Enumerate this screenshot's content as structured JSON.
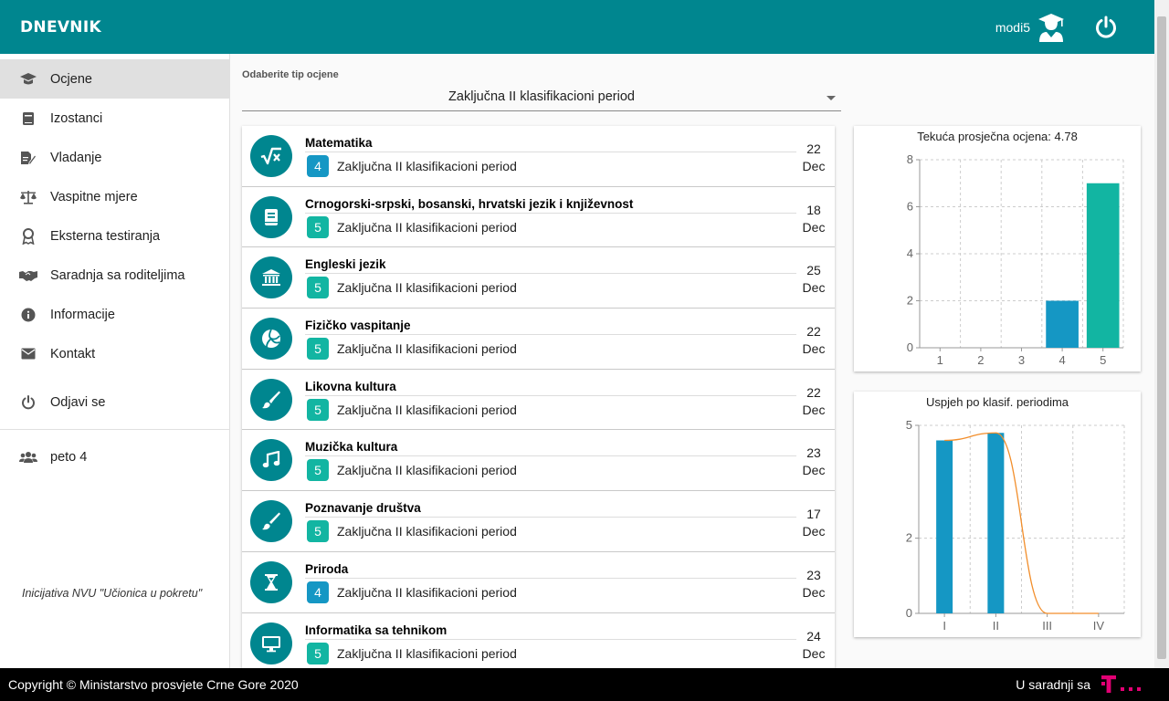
{
  "header": {
    "brand": "DNEVNIK",
    "username": "modi5"
  },
  "sidebar": {
    "items": [
      {
        "label": "Ocjene",
        "icon": "graduation-cap-icon",
        "active": true
      },
      {
        "label": "Izostanci",
        "icon": "book-icon"
      },
      {
        "label": "Vladanje",
        "icon": "edit-document-icon"
      },
      {
        "label": "Vaspitne mjere",
        "icon": "scale-icon"
      },
      {
        "label": "Eksterna testiranja",
        "icon": "award-ribbon-icon"
      },
      {
        "label": "Saradnja sa roditeljima",
        "icon": "handshake-icon"
      },
      {
        "label": "Informacije",
        "icon": "info-icon"
      },
      {
        "label": "Kontakt",
        "icon": "envelope-icon"
      }
    ],
    "logout_label": "Odjavi se",
    "class_label": "peto 4",
    "initiative": "Inicijativa NVU \"Učionica u pokretu\""
  },
  "filter": {
    "caption": "Odaberite tip ocjene",
    "selected": "Zaključna II klasifikacioni period"
  },
  "grades": [
    {
      "subject": "Matematika",
      "grade": "4",
      "period": "Zaključna II klasifikacioni period",
      "day": "22",
      "month": "Dec",
      "icon": "square-root-icon"
    },
    {
      "subject": "Crnogorski-srpski, bosanski, hrvatski jezik i književnost",
      "grade": "5",
      "period": "Zaključna II klasifikacioni period",
      "day": "18",
      "month": "Dec",
      "icon": "book-icon"
    },
    {
      "subject": "Engleski jezik",
      "grade": "5",
      "period": "Zaključna II klasifikacioni period",
      "day": "25",
      "month": "Dec",
      "icon": "bank-building-icon"
    },
    {
      "subject": "Fizičko vaspitanje",
      "grade": "5",
      "period": "Zaključna II klasifikacioni period",
      "day": "22",
      "month": "Dec",
      "icon": "volleyball-icon"
    },
    {
      "subject": "Likovna kultura",
      "grade": "5",
      "period": "Zaključna II klasifikacioni period",
      "day": "22",
      "month": "Dec",
      "icon": "paint-brush-icon"
    },
    {
      "subject": "Muzička kultura",
      "grade": "5",
      "period": "Zaključna II klasifikacioni period",
      "day": "23",
      "month": "Dec",
      "icon": "music-note-icon"
    },
    {
      "subject": "Poznavanje društva",
      "grade": "5",
      "period": "Zaključna II klasifikacioni period",
      "day": "17",
      "month": "Dec",
      "icon": "paint-brush-icon"
    },
    {
      "subject": "Priroda",
      "grade": "4",
      "period": "Zaključna II klasifikacioni period",
      "day": "23",
      "month": "Dec",
      "icon": "hourglass-icon"
    },
    {
      "subject": "Informatika sa tehnikom",
      "grade": "5",
      "period": "Zaključna II klasifikacioni period",
      "day": "24",
      "month": "Dec",
      "icon": "monitor-icon"
    }
  ],
  "chart_data": [
    {
      "type": "bar",
      "title": "Tekuća prosječna ocjena: 4.78",
      "categories": [
        "1",
        "2",
        "3",
        "4",
        "5"
      ],
      "values": [
        0,
        0,
        0,
        2,
        7
      ],
      "bar_colors": [
        "#1597c4",
        "#1597c4",
        "#1597c4",
        "#1597c4",
        "#12b5a2"
      ],
      "yticks": [
        0,
        2,
        4,
        6,
        8
      ],
      "ylim": [
        0,
        8
      ],
      "grid": true
    },
    {
      "type": "bar",
      "title": "Uspjeh po klasif. periodima",
      "categories": [
        "I",
        "II",
        "III",
        "IV"
      ],
      "values": [
        4.6,
        4.8,
        0,
        0
      ],
      "line_values": [
        4.6,
        4.8,
        0,
        0
      ],
      "bar_color": "#1597c4",
      "line_color": "#f28e2b",
      "yticks": [
        0,
        2,
        5
      ],
      "ylim": [
        0,
        5
      ],
      "grid": true
    }
  ],
  "footer": {
    "copyright": "Copyright © Ministarstvo prosvjete Crne Gore 2020",
    "partner": "U saradnji sa"
  },
  "colors": {
    "primary": "#00868f",
    "grade5": "#12b5a2",
    "grade4": "#1597c4",
    "telekom": "#e20074"
  }
}
